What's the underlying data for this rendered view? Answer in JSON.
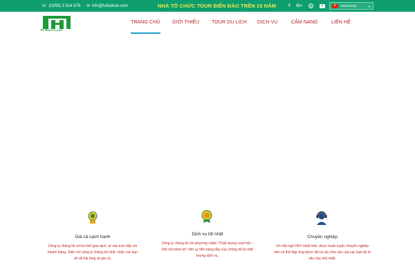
{
  "topbar": {
    "phone": "(0258) 3 524 678",
    "email": "info@tuhaitour.com",
    "tagline": "NHÀ TỔ CHỨC TOUR BIỂN ĐẢO TRÊN 15 NĂM",
    "social": {
      "facebook": "f",
      "google": "G+",
      "skype": "S"
    },
    "language": "Vietnamese"
  },
  "header": {
    "logo_text": "TU HAI Co.,Ltd"
  },
  "nav": {
    "items": [
      {
        "label": "TRANG CHỦ"
      },
      {
        "label": "GIỚI THIỆU"
      },
      {
        "label": "TOUR DU LỊCH"
      },
      {
        "label": "DỊCH VỤ"
      },
      {
        "label": "CẨM NANG"
      },
      {
        "label": "LIÊN HỆ"
      }
    ]
  },
  "features": [
    {
      "title": "Giá cả cạnh tranh",
      "desc": [
        "Công ty chúng tôi với lợi thế giao dịch, tư vấn trực tiếp với",
        "khách hàng.. Đến với công ty chúng tôi chắc chắn các bạn",
        "sẽ rất hài lòng về giá cả."
      ]
    },
    {
      "title": "Dịch vụ tốt nhất",
      "desc": [
        "Công ty chúng tôi với phương châm \"Chất lượng vượt trội –",
        "Kết nối niềm tin\" nên uy tiên hàng đầu của chúng tôi là chất",
        "lượng dịch vụ."
      ]
    },
    {
      "title": "Chuyên nghiệp",
      "desc": [
        "Với đội ngũ HDV nhiệt tình, được huấn luyện chuyên nghiệp",
        "nên có thể đáp ứng được tất cả các nhu cầu của các bạn dù là",
        "yêu cầu nhỏ nhất."
      ]
    }
  ],
  "colors": {
    "topbar": "#0e9e6e",
    "tagline": "#f7e34a",
    "nav_text": "#b0201c",
    "nav_active_underline": "#1aa0c9"
  }
}
